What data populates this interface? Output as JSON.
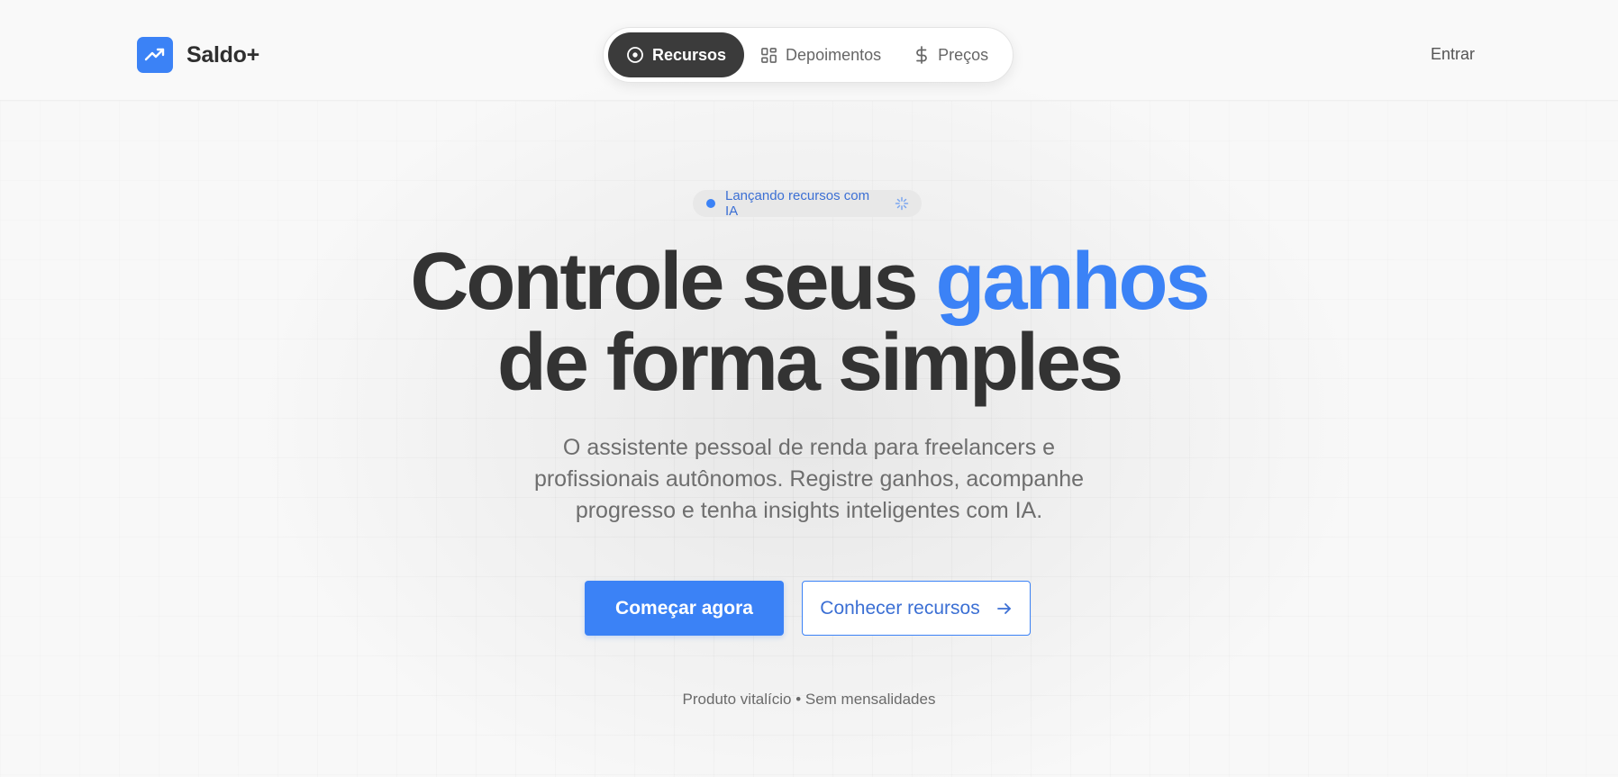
{
  "brand": {
    "name": "Saldo+",
    "logo_icon": "trending-up-icon",
    "color": "#3b82f6"
  },
  "nav": {
    "items": [
      {
        "label": "Recursos",
        "icon": "circle-dot-icon",
        "active": true
      },
      {
        "label": "Depoimentos",
        "icon": "layout-grid-icon",
        "active": false
      },
      {
        "label": "Preços",
        "icon": "dollar-sign-icon",
        "active": false
      }
    ],
    "login_label": "Entrar"
  },
  "hero": {
    "badge": {
      "label": "Lançando recursos com IA",
      "icon": "sparkle-icon"
    },
    "headline": {
      "part1": "Controle seus ",
      "accent": "ganhos",
      "line2": "de forma simples"
    },
    "subtitle": "O assistente pessoal de renda para freelancers e profissionais autônomos. Registre ganhos, acompanhe progresso e tenha insights inteligentes com IA.",
    "cta_primary": "Começar agora",
    "cta_secondary": "Conhecer recursos",
    "footnote": "Produto vitalício • Sem mensalidades"
  },
  "colors": {
    "accent": "#3b82f6",
    "dark": "#3b3b3b",
    "text": "#333333",
    "muted": "#6e6e6e"
  }
}
